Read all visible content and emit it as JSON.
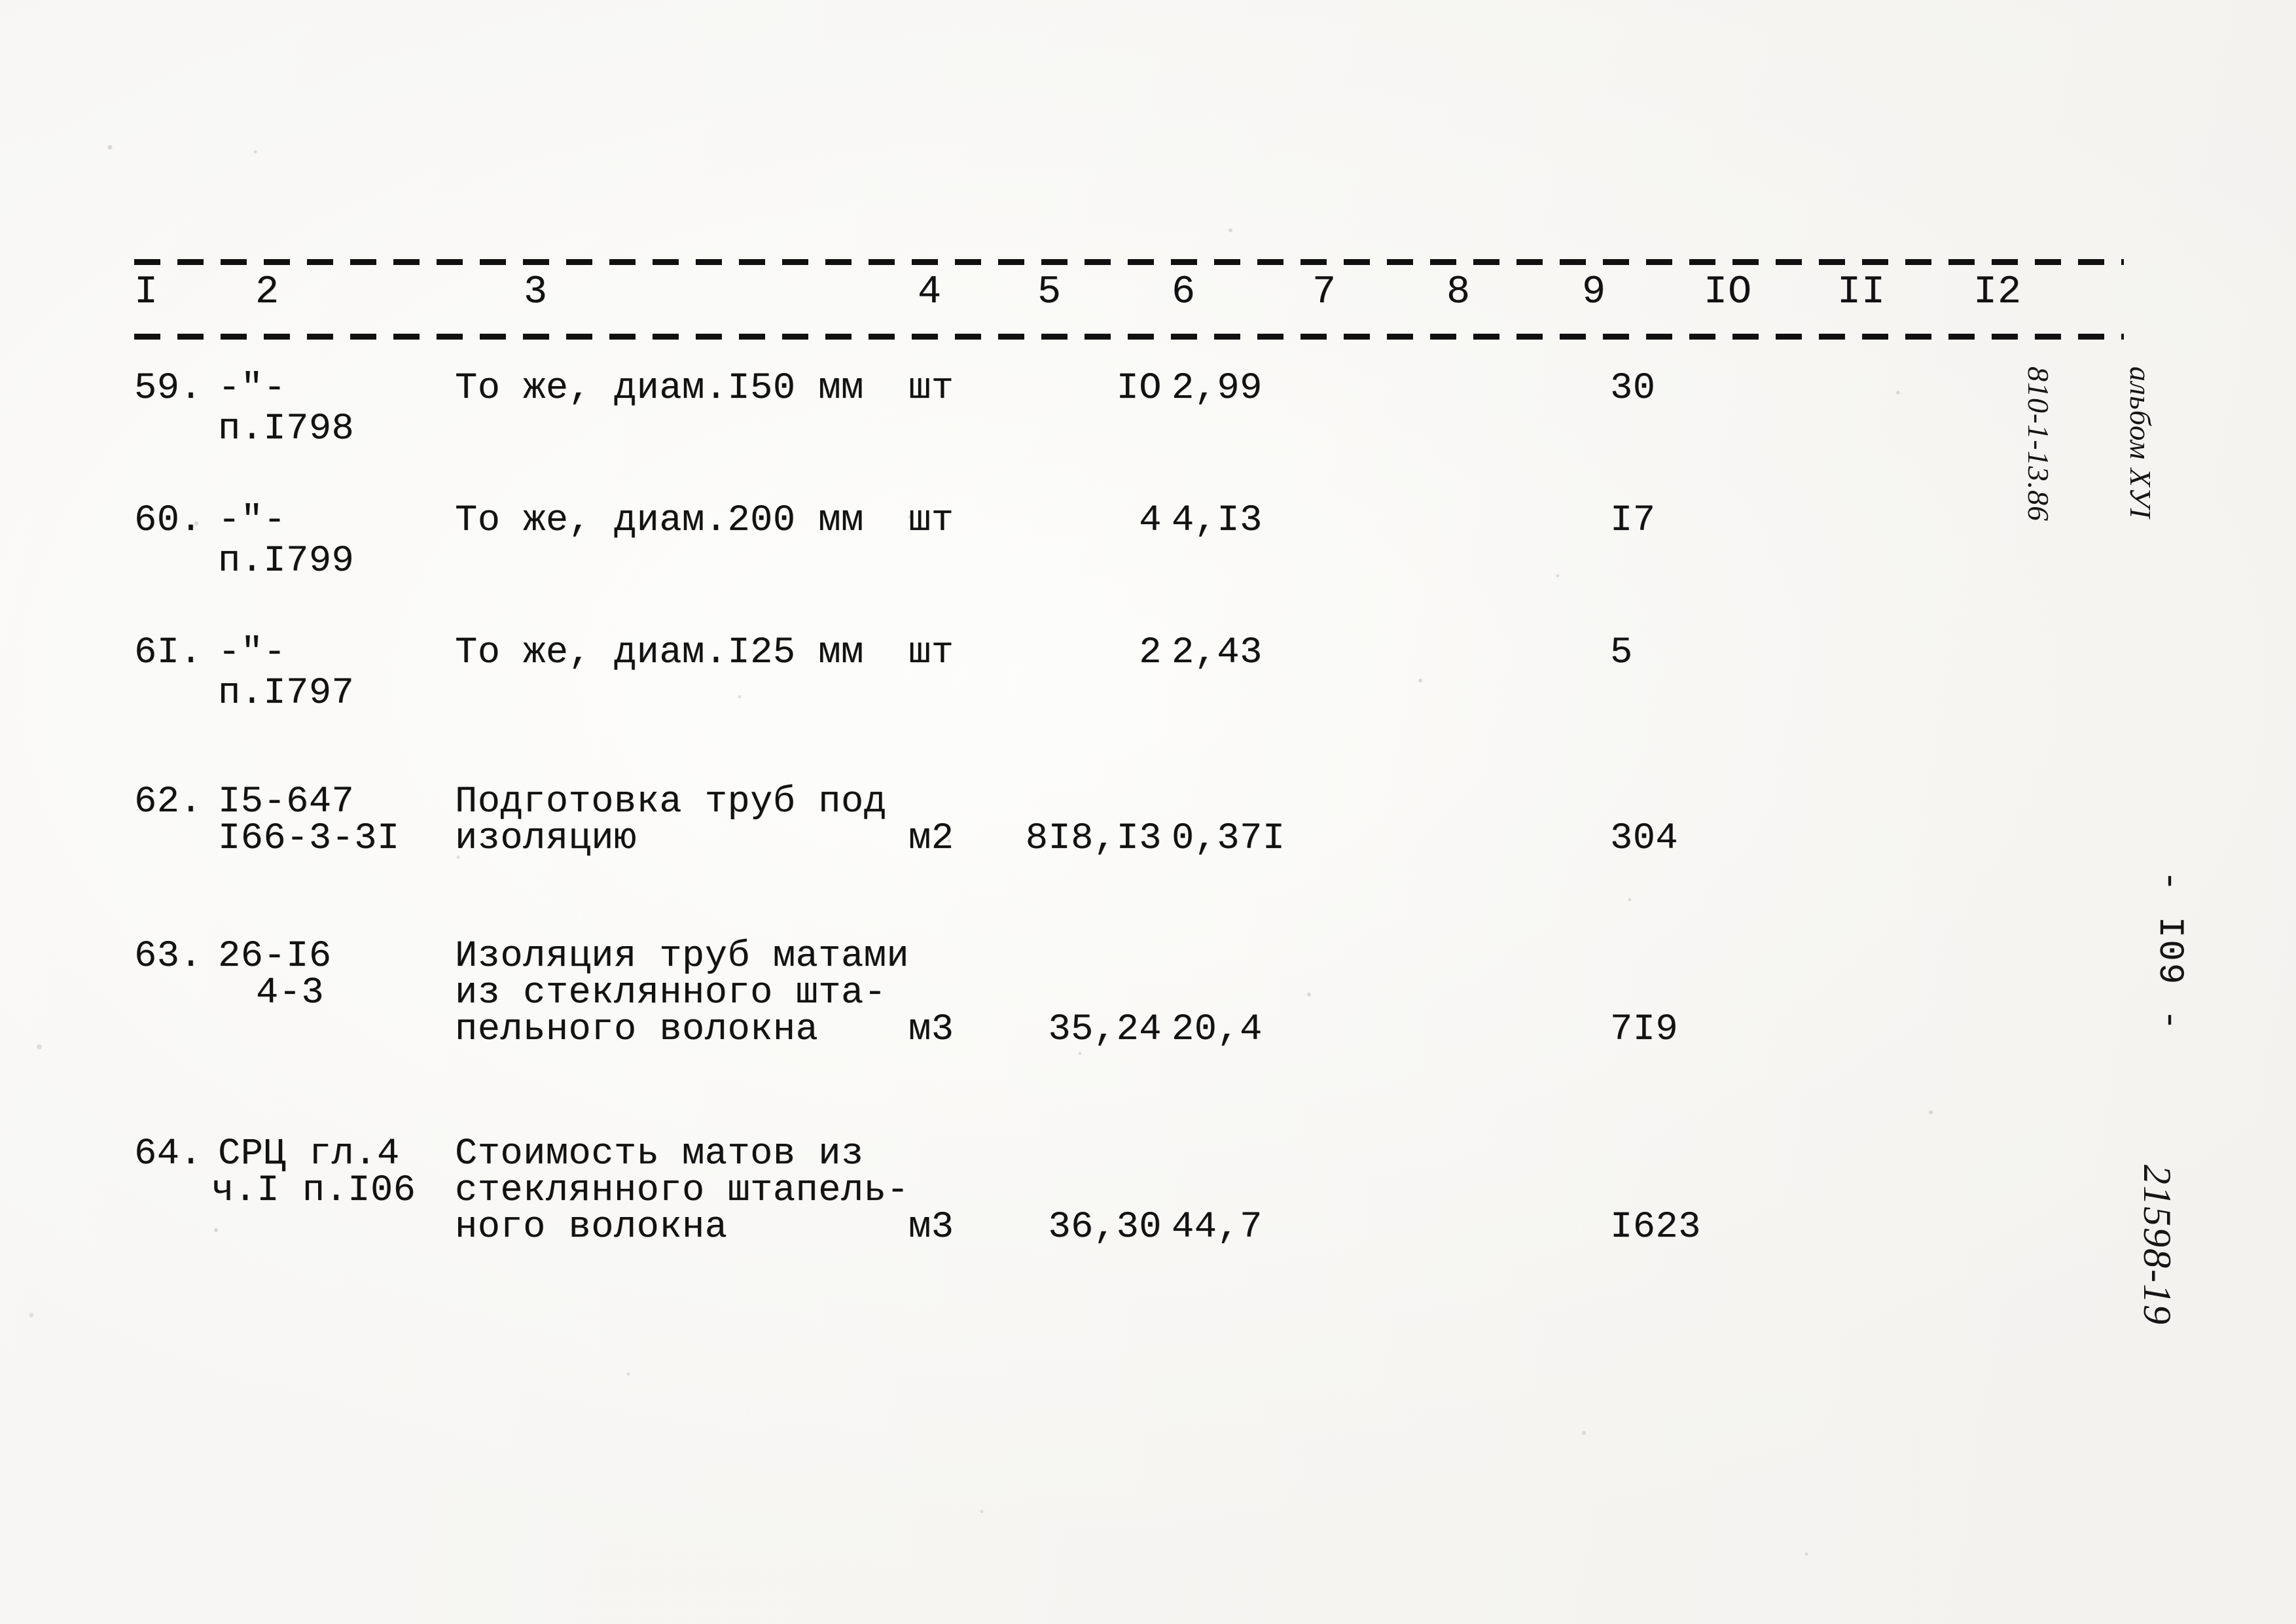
{
  "document": {
    "type": "scanned-estimate-table",
    "language": "ru"
  },
  "table": {
    "column_headers": [
      "I",
      "2",
      "3",
      "4",
      "5",
      "6",
      "7",
      "8",
      "9",
      "IO",
      "II",
      "I2"
    ],
    "rows": [
      {
        "num": "59.",
        "code_line1": "-\"-",
        "code_line2": "п.I798",
        "desc_line1": "То же, диам.I50 мм",
        "desc_line2": "",
        "desc_line3": "",
        "unit": "шт",
        "qty": "IO",
        "price": "2,99",
        "total": "30"
      },
      {
        "num": "60.",
        "code_line1": "-\"-",
        "code_line2": "п.I799",
        "desc_line1": "То же, диам.200 мм",
        "desc_line2": "",
        "desc_line3": "",
        "unit": "шт",
        "qty": "4",
        "price": "4,I3",
        "total": "I7"
      },
      {
        "num": "6I.",
        "code_line1": "-\"-",
        "code_line2": "п.I797",
        "desc_line1": "То же, диам.I25 мм",
        "desc_line2": "",
        "desc_line3": "",
        "unit": "шт",
        "qty": "2",
        "price": "2,43",
        "total": "5"
      },
      {
        "num": "62.",
        "code_line1": "I5-647",
        "code_line2": "I66-3-3I",
        "desc_line1": "Подготовка труб под",
        "desc_line2": "изоляцию",
        "desc_line3": "",
        "unit": "м2",
        "qty": "8I8,I3",
        "price": "0,37I",
        "total": "304"
      },
      {
        "num": "63.",
        "code_line1": "26-I6",
        "code_line2": "4-3",
        "desc_line1": "Изоляция труб матами",
        "desc_line2": "из стеклянного шта-",
        "desc_line3": "пельного волокна",
        "unit": "м3",
        "qty": "35,24",
        "price": "20,4",
        "total": "7I9"
      },
      {
        "num": "64.",
        "code_line1": "СРЦ гл.4",
        "code_line2": "ч.I п.I06",
        "desc_line1": "Стоимость матов из",
        "desc_line2": "стеклянного штапель-",
        "desc_line3": "ного волокна",
        "unit": "м3",
        "qty": "36,30",
        "price": "44,7",
        "total": "I623"
      }
    ]
  },
  "margin": {
    "album_line1": "альбом ХУI",
    "album_line2": "810-1-13.86",
    "page_number": "- I09 -",
    "order_number": "21598-19"
  },
  "colors": {
    "ink": "#121212",
    "paper": "#fdfdfc"
  }
}
